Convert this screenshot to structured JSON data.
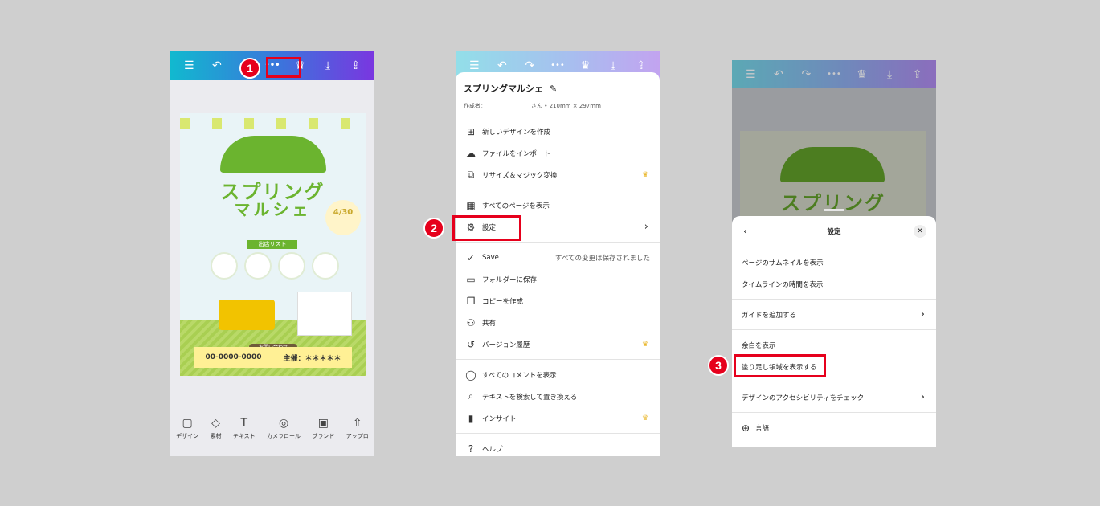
{
  "steps": [
    "1",
    "2",
    "3"
  ],
  "topbar": {
    "menu_icon": "☰",
    "undo_icon": "↶",
    "redo_icon": "↷",
    "more_icon": "•••",
    "crown_icon": "♛",
    "download_icon": "⤓",
    "share_icon": "⇪"
  },
  "poster": {
    "title_line1": "スプリング",
    "title_line2": "マルシェ",
    "date": "4/30",
    "list_header": "出店リスト",
    "contact_header": "お問い合わせ",
    "phone": "00-0000-0000",
    "organizer": "主催：＊＊＊＊＊"
  },
  "bottombar": [
    {
      "icon": "▢",
      "label": "デザイン"
    },
    {
      "icon": "◇",
      "label": "素材"
    },
    {
      "icon": "T",
      "label": "テキスト"
    },
    {
      "icon": "◎",
      "label": "カメラロール"
    },
    {
      "icon": "▣",
      "label": "ブランド"
    },
    {
      "icon": "⇧",
      "label": "アップロ"
    }
  ],
  "menu_sheet": {
    "title": "スプリングマルシェ",
    "edit_icon": "✎",
    "author_label": "作成者：",
    "meta": "さん • 210mm × 297mm",
    "items": [
      {
        "icon": "⊞",
        "label": "新しいデザインを作成"
      },
      {
        "icon": "☁",
        "label": "ファイルをインポート"
      },
      {
        "icon": "⧉",
        "label": "リサイズ＆マジック変換",
        "crown": "♛"
      },
      {
        "icon": "▦",
        "label": "すべてのページを表示"
      },
      {
        "icon": "⚙",
        "label": "設定",
        "chevron": "›"
      },
      {
        "icon": "✓",
        "label": "Save",
        "right": "すべての変更は保存されました"
      },
      {
        "icon": "▭",
        "label": "フォルダーに保存"
      },
      {
        "icon": "❐",
        "label": "コピーを作成"
      },
      {
        "icon": "⚇",
        "label": "共有"
      },
      {
        "icon": "↺",
        "label": "バージョン履歴",
        "crown": "♛"
      },
      {
        "icon": "◯",
        "label": "すべてのコメントを表示"
      },
      {
        "icon": "⌕",
        "label": "テキストを検索して置き換える"
      },
      {
        "icon": "▮",
        "label": "インサイト",
        "crown": "♛"
      },
      {
        "icon": "?",
        "label": "ヘルプ"
      }
    ]
  },
  "settings": {
    "title": "設定",
    "back_icon": "‹",
    "close_icon": "✕",
    "items": [
      {
        "label": "ページのサムネイルを表示"
      },
      {
        "label": "タイムラインの時間を表示"
      },
      {
        "label": "ガイドを追加する",
        "chevron": "›"
      },
      {
        "label": "余白を表示"
      },
      {
        "label": "塗り足し領域を表示する"
      },
      {
        "label": "デザインのアクセシビリティをチェック",
        "chevron": "›"
      },
      {
        "icon": "⊕",
        "label": "言語"
      }
    ]
  },
  "colors": {
    "accent_red": "#e6001c",
    "poster_green": "#6bb42f",
    "crown_gold": "#e8b11b"
  }
}
